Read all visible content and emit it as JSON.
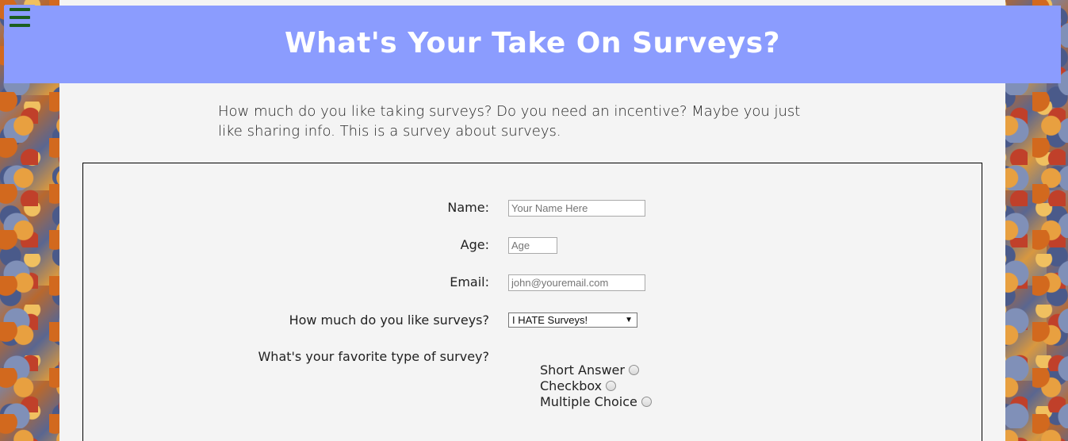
{
  "header": {
    "title": "What's Your Take On Surveys?"
  },
  "intro": "How much do you like taking surveys? Do you need an incentive? Maybe you just like sharing info. This is a survey about surveys.",
  "form": {
    "name_label": "Name:",
    "name_placeholder": "Your Name Here",
    "age_label": "Age:",
    "age_placeholder": "Age",
    "email_label": "Email:",
    "email_placeholder": "john@youremail.com",
    "like_label": "How much do you like surveys?",
    "like_selected": "I HATE Surveys!",
    "favorite_label": "What's your favorite type of survey?",
    "favorite_options": [
      "Short Answer",
      "Checkbox",
      "Multiple Choice"
    ]
  },
  "colors": {
    "header_bg": "#8b9cfe",
    "menu_icon": "#1b5e20",
    "panel_bg": "#f4f4f4"
  },
  "icons": {
    "menu": "hamburger-menu-icon",
    "select_arrow": "chevron-down-icon"
  }
}
